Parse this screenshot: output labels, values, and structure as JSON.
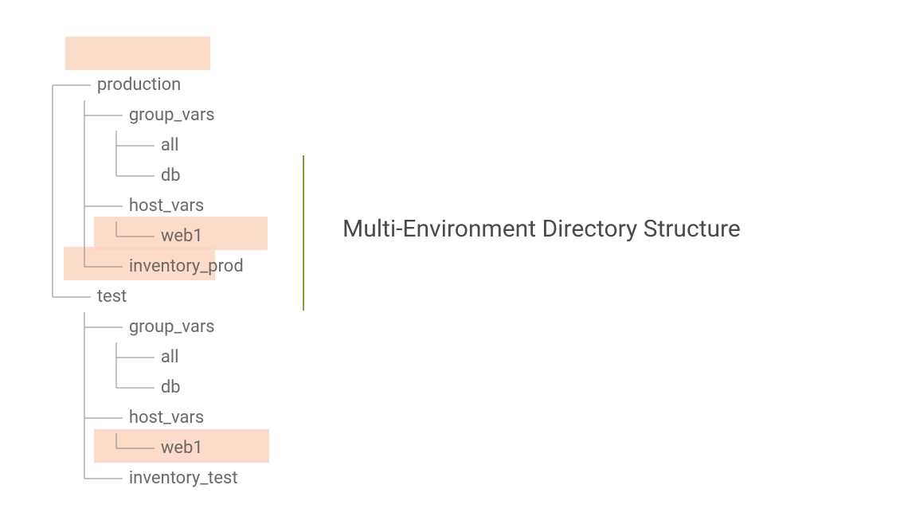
{
  "title": "Multi-Environment Directory Structure",
  "tree": {
    "l0": "production",
    "l1": "group_vars",
    "l2": "all",
    "l3": "db",
    "l4": "host_vars",
    "l5": "web1",
    "l6": "inventory_prod",
    "l7": "test",
    "l8": "group_vars",
    "l9": "all",
    "l10": "db",
    "l11": "host_vars",
    "l12": "web1",
    "l13": "inventory_test"
  },
  "colors": {
    "highlight": "#fbd5bf",
    "divider": "#8a9a3a",
    "text": "#6a6a6a"
  }
}
